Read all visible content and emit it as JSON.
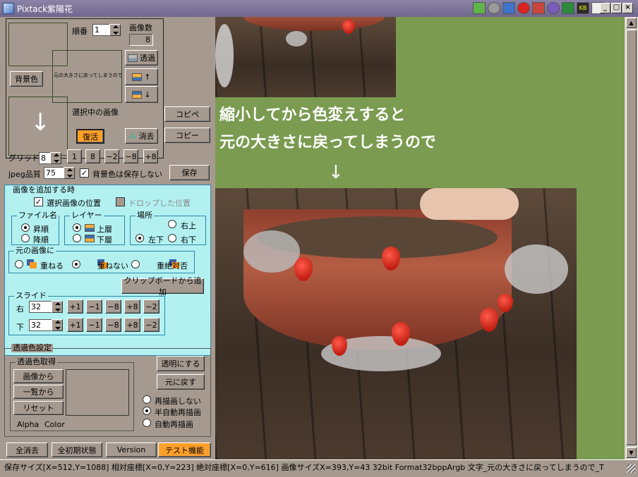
{
  "window": {
    "title": "Pixtack紫陽花"
  },
  "tray_icons": [
    "download-icon",
    "gear-icon",
    "monitor-icon",
    "bug-icon",
    "pen-icon",
    "orb-icon",
    "spreadsheet-icon",
    "kb-icon",
    "calendar-icon"
  ],
  "preview": {
    "order_label": "順番",
    "order_value": "1",
    "image_count_label": "画像数",
    "image_count_value": "8",
    "transparent_label": "透過",
    "bg_color_label": "背景色",
    "thumb_text": "元の大きさに戻ってしまうので",
    "selected_label": "選択中の画像",
    "arrow_glyph": "↓",
    "restore_label": "復活",
    "erase_label": "消去",
    "copy_paste_label": "コピペ",
    "copy_label": "コピー"
  },
  "grid": {
    "label": "グリッド",
    "value": "8",
    "buttons": [
      "1",
      "8",
      "−2",
      "−8",
      "+8"
    ]
  },
  "jpeg": {
    "label": "jpeg品質",
    "value": "75",
    "no_save_bg_label": "背景色は保存しない",
    "save_label": "保存"
  },
  "add_image": {
    "title": "画像を追加する時",
    "selected_pos_label": "選択画像の位置",
    "dropped_pos_label": "ドロップした位置",
    "filename": {
      "title": "ファイル名",
      "asc": "昇順",
      "desc": "降順"
    },
    "layer": {
      "title": "レイヤー",
      "top": "上層",
      "bottom": "下層"
    },
    "place": {
      "title": "場所",
      "top_right": "右上",
      "bottom_left": "左下",
      "bottom_right": "右下"
    },
    "original": {
      "title": "元の画像に",
      "overlap": "重ねる",
      "no_overlap": "重ねない",
      "never_overlap": "重絶対否"
    },
    "clipboard_add_label": "クリップボードから追加",
    "slide": {
      "title": "スライド",
      "right_label": "右",
      "right_value": "32",
      "down_label": "下",
      "down_value": "32",
      "buttons": [
        "+1",
        "−1",
        "−8",
        "+8",
        "−2"
      ]
    }
  },
  "transparency": {
    "title": "透過色設定",
    "pick_title": "透過色取得",
    "from_image": "画像から",
    "from_list": "一覧から",
    "reset": "リセット",
    "alpha_label": "Alpha",
    "color_label": "Color",
    "make_transparent": "透明にする",
    "restore": "元に戻す",
    "no_redraw": "再描画しない",
    "semi_auto_redraw": "半自動再描画",
    "auto_redraw": "自動再描画"
  },
  "bottom_buttons": {
    "clear_all": "全消去",
    "reset_all": "全初期状態",
    "version": "Version",
    "test": "テスト機能"
  },
  "canvas": {
    "line1": "縮小してから色変えすると",
    "line2": "元の大きさに戻ってしまうので",
    "arrow": "↓",
    "bg_color": "#7a9b50"
  },
  "status": {
    "text": "保存サイズ[X=512,Y=1088]  相対座標[X=0,Y=223]  絶対座標[X=0,Y=616]  画像サイズX=393,Y=43  32bit  Format32bppArgb  文字_元の大きさに戻ってしまうので_T"
  }
}
